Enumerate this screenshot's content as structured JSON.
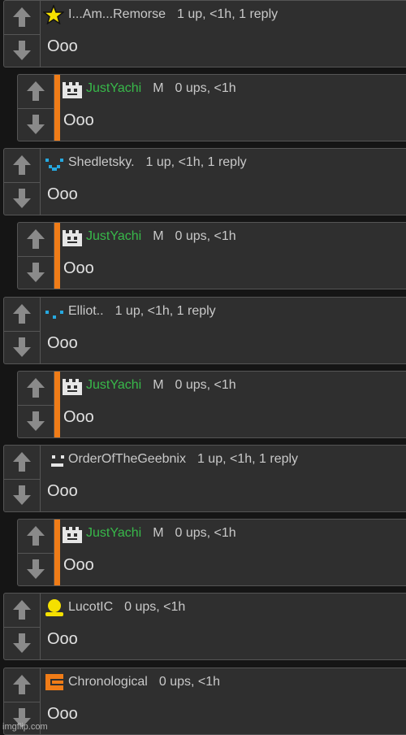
{
  "comments": [
    {
      "username": "I...Am...Remorse",
      "meta": "1 up, <1h, 1 reply",
      "text": "Ooo",
      "avatar": "star-icon"
    },
    {
      "username": "JustYachi",
      "mod": "M",
      "meta": "0 ups, <1h",
      "text": "Ooo",
      "avatar": "pixel-face-icon"
    },
    {
      "username": "Shedletsky.",
      "meta": "1 up, <1h, 1 reply",
      "text": "Ooo",
      "avatar": "smile-face-icon"
    },
    {
      "username": "JustYachi",
      "mod": "M",
      "meta": "0 ups, <1h",
      "text": "Ooo",
      "avatar": "pixel-face-icon"
    },
    {
      "username": "Elliot..",
      "meta": "1 up, <1h, 1 reply",
      "text": "Ooo",
      "avatar": "dots-face-icon"
    },
    {
      "username": "JustYachi",
      "mod": "M",
      "meta": "0 ups, <1h",
      "text": "Ooo",
      "avatar": "pixel-face-icon"
    },
    {
      "username": "OrderOfTheGeebnix",
      "meta": "1 up, <1h, 1 reply",
      "text": "Ooo",
      "avatar": "flat-face-icon"
    },
    {
      "username": "JustYachi",
      "mod": "M",
      "meta": "0 ups, <1h",
      "text": "Ooo",
      "avatar": "pixel-face-icon"
    },
    {
      "username": "LucotIC",
      "meta": "0 ups, <1h",
      "text": "Ooo",
      "avatar": "person-icon"
    },
    {
      "username": "Chronological",
      "meta": "0 ups, <1h",
      "text": "Ooo",
      "avatar": "orange-block-icon"
    }
  ],
  "colors": {
    "background": "#151515",
    "panel": "#2f2f2f",
    "border": "#555555",
    "reply_bar": "#f07c17",
    "mod_name": "#38b94a",
    "meta": "#c9c9c9"
  },
  "watermark": "imgflip.com"
}
